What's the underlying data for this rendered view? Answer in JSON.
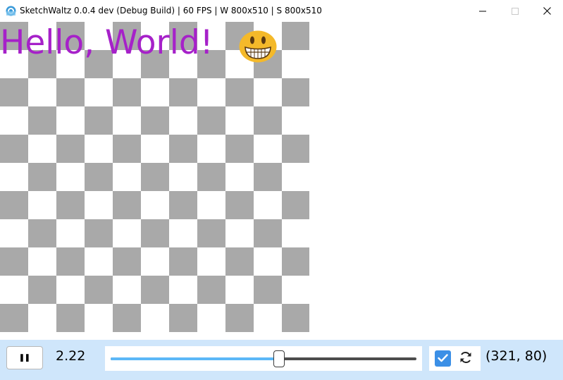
{
  "window": {
    "title": "SketchWaltz 0.0.4 dev (Debug Build) | 60 FPS | W 800x510 | S 800x510",
    "app_icon": "sketchwaltz-app-icon",
    "controls": {
      "minimize_icon": "minimize-icon",
      "maximize_icon": "maximize-icon",
      "close_icon": "close-icon"
    }
  },
  "canvas": {
    "background": "#ffffff",
    "checker": {
      "rows": 11,
      "cols": 11,
      "light": "#ffffff",
      "dark": "#a9a9a9"
    },
    "greeting": "Hello, World!",
    "greeting_color": "#a621c9",
    "emoji": "grinning-face-emoji"
  },
  "toolbar": {
    "background": "#cfe6fb",
    "pause_label": "❚❚",
    "value_label": "2.22",
    "slider": {
      "fraction": 0.55,
      "fill_color": "#5cb8f7"
    },
    "checkbox_checked": true,
    "checkbox_color": "#3b8fe6",
    "refresh_icon": "refresh-icon",
    "coordinate_label": "(321, 80)"
  }
}
